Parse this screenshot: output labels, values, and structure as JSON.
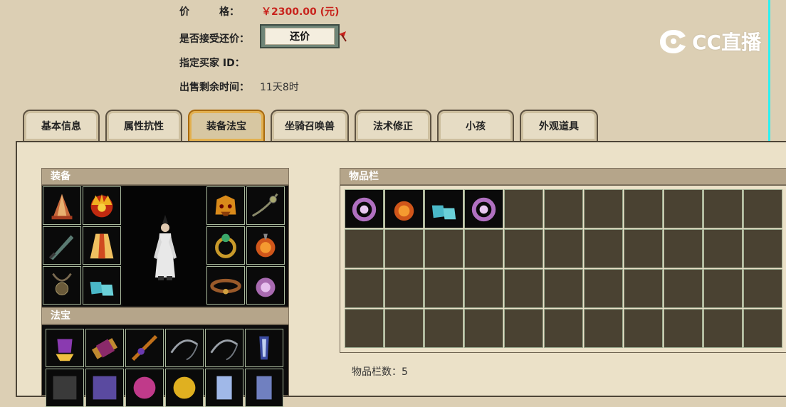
{
  "info": {
    "price_label": "价　　　格：",
    "price_value": "￥2300.00 (元)",
    "counter_label": "是否接受还价：",
    "counter_button": "还价",
    "buyer_label": "指定买家 ID：",
    "time_label": "出售剩余时间：",
    "time_value": "11天8时"
  },
  "watermark": "CC直播",
  "tabs": [
    {
      "label": "基本信息",
      "active": false
    },
    {
      "label": "属性抗性",
      "active": false
    },
    {
      "label": "装备法宝",
      "active": true
    },
    {
      "label": "坐骑召唤兽",
      "active": false
    },
    {
      "label": "法术修正",
      "active": false
    },
    {
      "label": "小孩",
      "active": false
    },
    {
      "label": "外观道具",
      "active": false
    }
  ],
  "sections": {
    "equipment": "装备",
    "treasure": "法宝",
    "inventory": "物品栏",
    "inventory_count_label": "物品栏数：",
    "inventory_count": "5"
  },
  "equipment_items": [
    "hat-icon",
    "crown-icon",
    "helmet-icon",
    "necklace-icon",
    "sword-icon",
    "robe-icon",
    "ring-icon",
    "orb-icon",
    "pendant-icon",
    "boots-icon",
    "belt-icon",
    "bracelet-icon"
  ],
  "treasure_items": [
    "bell-icon",
    "scroll-icon",
    "flute-icon",
    "whip-icon",
    "whip-icon",
    "claw-icon"
  ],
  "inventory_items": [
    "bracelet-icon",
    "orb-icon",
    "boots-icon",
    "bracelet-icon"
  ],
  "colors": {
    "price": "#c8231c",
    "accent_cyan": "#2ef0f0",
    "active_tab_border": "#a8690e"
  }
}
